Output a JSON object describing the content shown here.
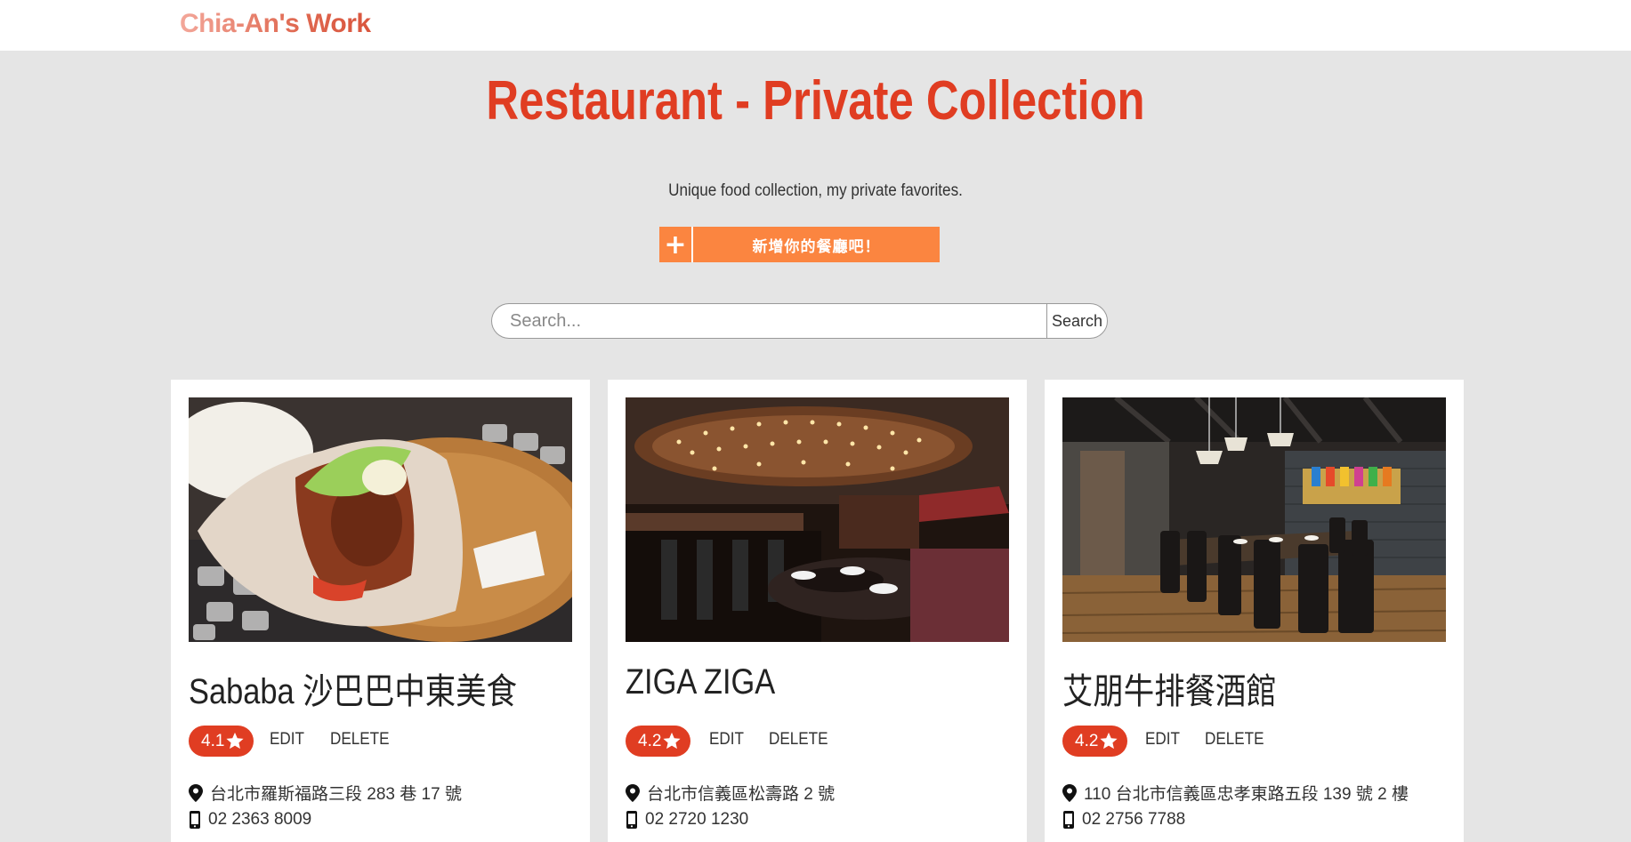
{
  "brand": "Chia-An's Work",
  "title": "Restaurant - Private Collection",
  "subtitle": "Unique food collection, my private favorites.",
  "add_button": {
    "icon": "plus-icon",
    "label": "新增你的餐廳吧！"
  },
  "search": {
    "placeholder": "Search...",
    "value": "",
    "button_label": "Search"
  },
  "colors": {
    "accent": "#e03d22",
    "button": "#fb8540",
    "background": "#e5e5e5"
  },
  "restaurants": [
    {
      "name": "Sababa 沙巴巴中東美食",
      "rating": "4.1",
      "edit_label": "EDIT",
      "delete_label": "DELETE",
      "address": "台北市羅斯福路三段 283 巷 17 號",
      "phone": "02 2363 8009",
      "image": "pita-sandwich-photo"
    },
    {
      "name": "ZIGA ZIGA",
      "rating": "4.2",
      "edit_label": "EDIT",
      "delete_label": "DELETE",
      "address": "台北市信義區松壽路 2 號",
      "phone": "02 2720 1230",
      "image": "restaurant-interior-photo"
    },
    {
      "name": "艾朋牛排餐酒館",
      "rating": "4.2",
      "edit_label": "EDIT",
      "delete_label": "DELETE",
      "address": "110 台北市信義區忠孝東路五段 139 號 2 樓",
      "phone": "02 2756 7788",
      "image": "private-dining-room-photo"
    }
  ]
}
